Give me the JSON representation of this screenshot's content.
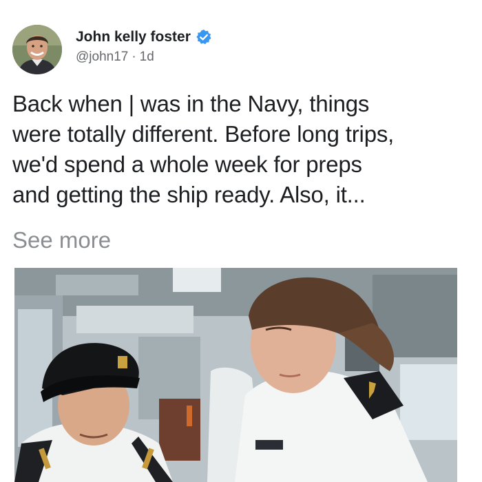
{
  "post": {
    "author": {
      "name": "John kelly foster",
      "handle": "@john17",
      "separator": "·",
      "time": "1d",
      "avatar_icon": "profile-photo",
      "verified_icon": "verified-badge-icon",
      "verified_color": "#3897f0"
    },
    "text_lines": [
      "Back when | was in the Navy, things",
      "were totally different. Before long trips,",
      "we'd spend a whole week for preps",
      "and getting the ship ready. Also, it..."
    ],
    "see_more": "See more",
    "photo": {
      "description_icon": "navy-officers-photo"
    }
  },
  "colors": {
    "text": "#1c1e21",
    "secondary": "#65676b",
    "see_more": "#8a8d91"
  }
}
